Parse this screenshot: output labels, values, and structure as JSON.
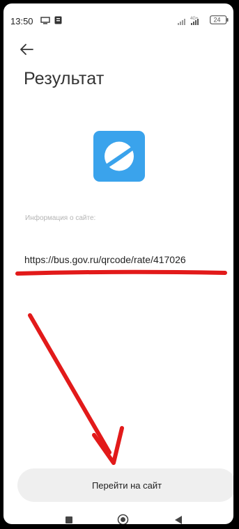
{
  "status_bar": {
    "time": "13:50",
    "network_label": "4G+",
    "battery_level": "24",
    "icons": [
      "cast-icon",
      "notification-icon",
      "signal-icon",
      "battery-icon"
    ]
  },
  "header": {
    "back_icon": "arrow-left-icon",
    "title": "Результат"
  },
  "app_icon": {
    "name": "browser-compass-icon",
    "color": "#3aa3ec"
  },
  "info": {
    "label": "Информация о сайте:",
    "url": "https://bus.gov.ru/qrcode/rate/417026"
  },
  "annotations": {
    "color": "#e21a1a",
    "marks": [
      "underline",
      "arrow-down-right"
    ]
  },
  "action": {
    "button_label": "Перейти на сайт"
  },
  "nav": {
    "items": [
      "recents-square-icon",
      "home-circle-icon",
      "back-triangle-icon"
    ]
  }
}
